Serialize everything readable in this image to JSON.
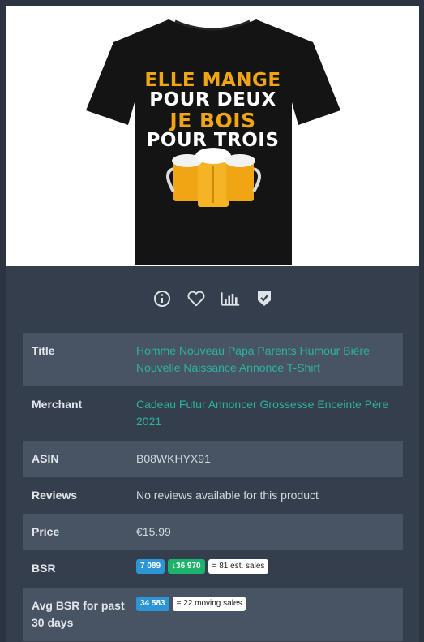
{
  "product_image": {
    "shirt_text": [
      "ELLE MANGE",
      "POUR DEUX",
      "JE BOIS",
      "POUR TROIS"
    ],
    "accent_color": "#f0a515"
  },
  "actions": [
    {
      "name": "info-icon"
    },
    {
      "name": "heart-icon"
    },
    {
      "name": "bar-chart-icon"
    },
    {
      "name": "shield-check-icon"
    }
  ],
  "details": {
    "title_label": "Title",
    "title_value": "Homme Nouveau Papa Parents Humour Bière Nouvelle Naissance Annonce T-Shirt",
    "merchant_label": "Merchant",
    "merchant_value": "Cadeau Futur Annoncer Grossesse Enceinte Père 2021",
    "asin_label": "ASIN",
    "asin_value": "B08WKHYX91",
    "reviews_label": "Reviews",
    "reviews_value": "No reviews available for this product",
    "price_label": "Price",
    "price_value": "€15.99",
    "bsr_label": "BSR",
    "bsr_current": "7 089",
    "bsr_low": "36 970",
    "bsr_sales": "= 81 est. sales",
    "avg_bsr_label": "Avg BSR for past 30 days",
    "avg_bsr_value": "34 583",
    "avg_bsr_sales": "= 22 moving sales"
  },
  "colors": {
    "link": "#2bb3a0",
    "badge_blue": "#2c95d6",
    "badge_green": "#1fb26b"
  }
}
